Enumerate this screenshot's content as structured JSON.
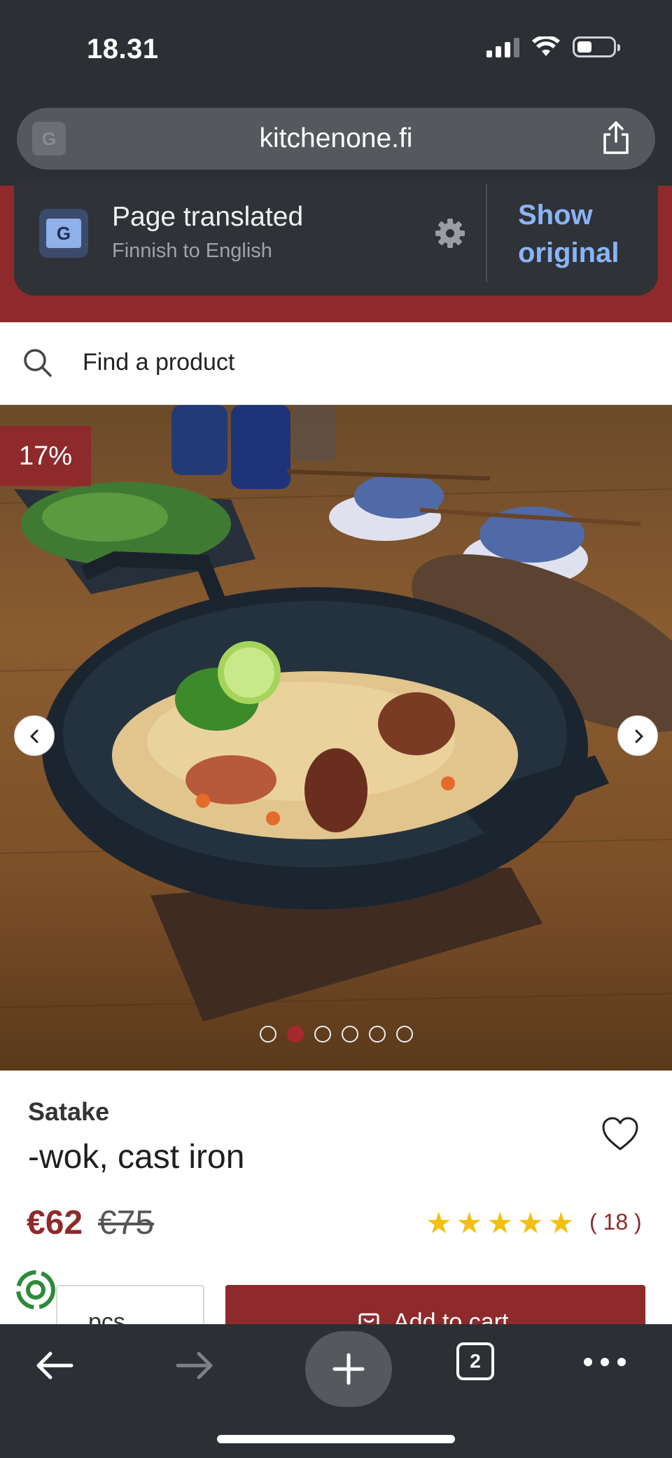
{
  "status_bar": {
    "time": "18.31"
  },
  "browser": {
    "url": "kitchenone.fi"
  },
  "translate_popup": {
    "title": "Page translated",
    "subtitle": "Finnish to English",
    "show_original": "Show original"
  },
  "search": {
    "placeholder": "Find a product"
  },
  "product_image": {
    "discount_badge": "17%",
    "carousel_dots": 6,
    "active_dot_index": 1
  },
  "product": {
    "brand": "Satake",
    "name": "-wok, cast iron",
    "price_now": "€62",
    "price_old": "€75",
    "rating_stars": 5,
    "review_count": "( 18 )"
  },
  "purchase": {
    "qty_unit": "pcs",
    "add_to_cart": "Add to cart"
  },
  "bottom_toolbar": {
    "tab_count": "2"
  },
  "colors": {
    "brand_red": "#8e2a2b",
    "link_blue": "#8ab4f8",
    "star_yellow": "#f2c10f",
    "chrome_dark": "#2c2f33"
  }
}
